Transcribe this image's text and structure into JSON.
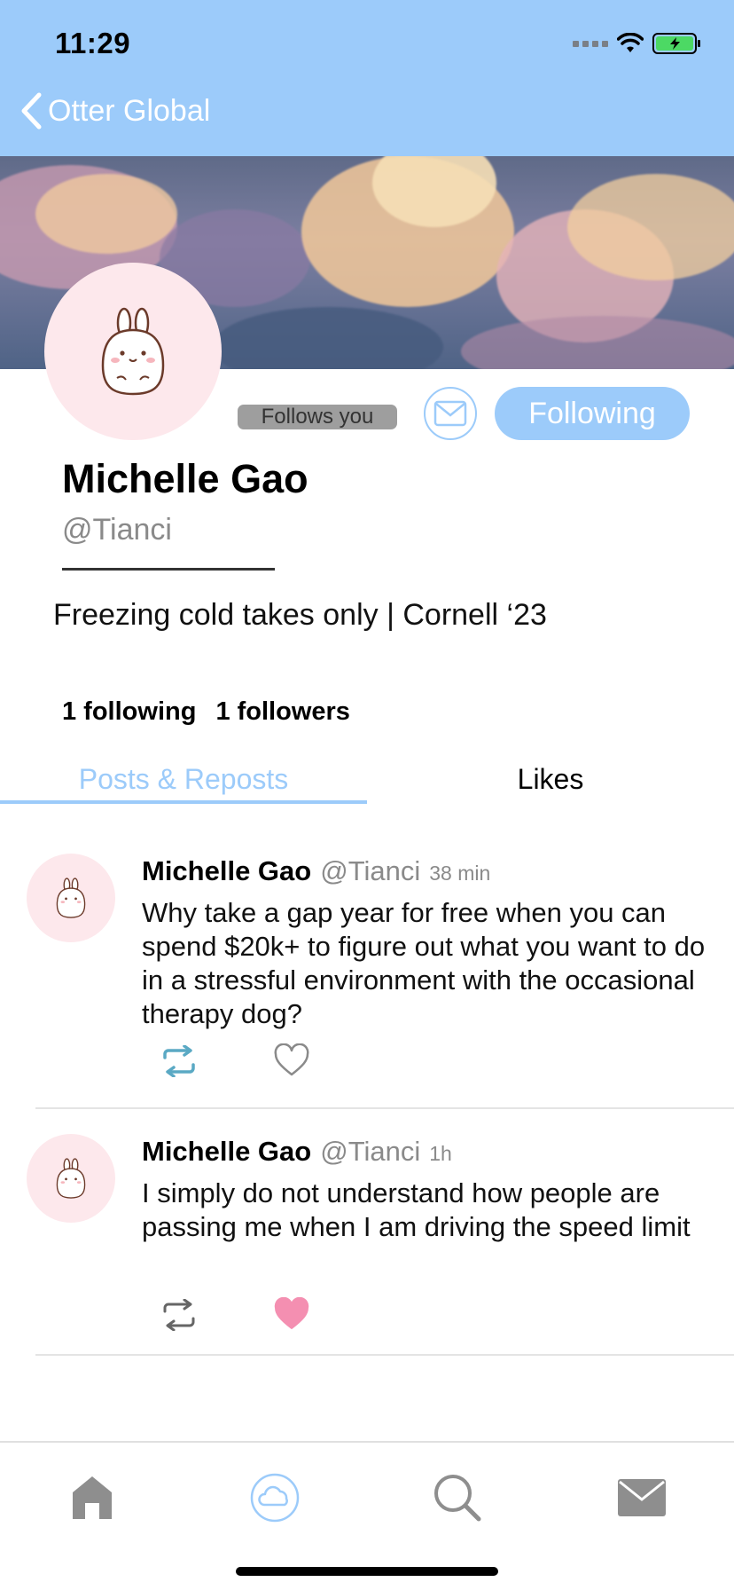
{
  "status_bar": {
    "time": "11:29"
  },
  "nav": {
    "back_label": "Otter Global"
  },
  "profile": {
    "name": "Michelle Gao",
    "handle": "@Tianci",
    "follows_you": "Follows you",
    "following_button": "Following",
    "bio": "Freezing cold takes only | Cornell ‘23",
    "following_count": "1 following",
    "followers_count": "1 followers"
  },
  "tabs": [
    {
      "label": "Posts & Reposts",
      "active": true
    },
    {
      "label": "Likes",
      "active": false
    }
  ],
  "posts": [
    {
      "name": "Michelle Gao",
      "handle": "@Tianci",
      "time": "38 min",
      "text": "Why take a gap year for free when you can spend $20k+ to figure out what you want to do in a stressful environment with the occasional therapy dog?",
      "reposted": true,
      "liked": false
    },
    {
      "name": "Michelle Gao",
      "handle": "@Tianci",
      "time": "1h",
      "text": "I simply do not understand how people are passing me when I am driving the speed limit",
      "reposted": false,
      "liked": true
    }
  ],
  "bottom_nav": [
    {
      "icon": "home-icon",
      "active": false
    },
    {
      "icon": "cloud-icon",
      "active": true
    },
    {
      "icon": "search-icon",
      "active": false
    },
    {
      "icon": "mail-icon",
      "active": false
    }
  ],
  "colors": {
    "accent": "#9ccbfa",
    "like": "#f48fb1",
    "repost_active": "#5aa9c4",
    "avatar_bg": "#fde8ec"
  }
}
